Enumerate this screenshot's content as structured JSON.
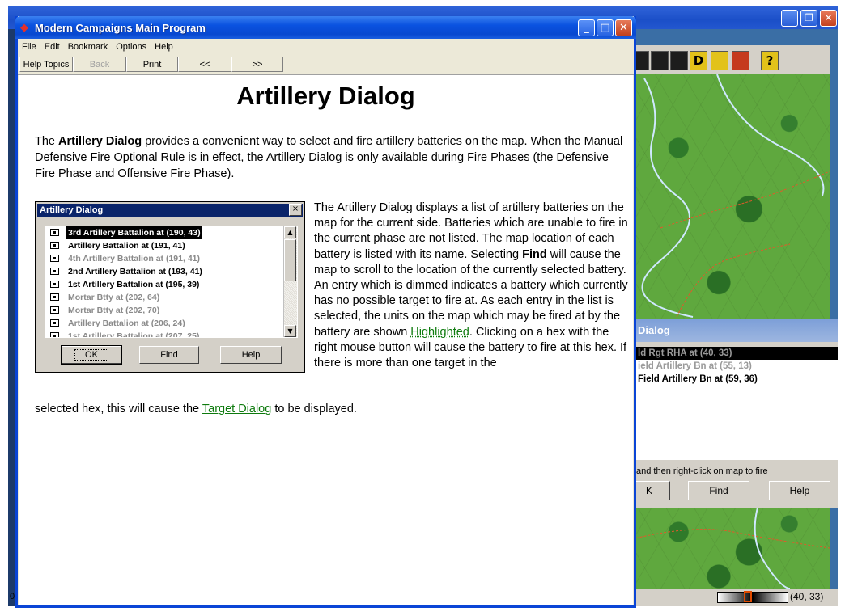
{
  "help_window": {
    "title": "Modern Campaigns Main Program",
    "menu": [
      "File",
      "Edit",
      "Bookmark",
      "Options",
      "Help"
    ],
    "toolbar": {
      "help_topics": "Help Topics",
      "back": "Back",
      "print": "Print",
      "prev": "<<",
      "next": ">>"
    }
  },
  "page": {
    "title": "Artillery Dialog",
    "intro_prefix": "The ",
    "intro_bold": "Artillery Dialog",
    "intro_rest": " provides a convenient way to select and fire artillery batteries on the map.  When the Manual Defensive Fire Optional Rule is in effect, the Artillery Dialog is only available during Fire Phases (the Defensive Fire Phase and Offensive Fire Phase).",
    "body_part1": "The Artillery Dialog displays a list of artillery batteries on the map for the current side.  Batteries which are unable to fire in the current phase are not listed.  The map location of each battery is listed with its name. Selecting ",
    "body_find": "Find",
    "body_part2": " will cause the map to scroll to the location of the currently selected battery.  An entry which is dimmed indicates a battery which currently has no possible target to fire at.  As each entry in the list is selected, the units on the map which may be fired at by the battery are shown ",
    "link_highlighted": "Highlighted",
    "body_part3": ".  Clicking on a hex with the right mouse button will cause the battery to fire at this hex.  If there is more than one target in the",
    "tail_part1": "selected hex, this will cause the ",
    "link_target_dialog": "Target Dialog",
    "tail_part2": " to be displayed."
  },
  "embedded_dialog": {
    "title": "Artillery Dialog",
    "close": "×",
    "rows": [
      {
        "text": "3rd Artillery Battalion at (190, 43)",
        "state": "selected"
      },
      {
        "text": "Artillery Battalion at (191, 41)",
        "state": "normal"
      },
      {
        "text": "4th Artillery Battalion at (191, 41)",
        "state": "dimmed"
      },
      {
        "text": "2nd Artillery Battalion at (193, 41)",
        "state": "normal"
      },
      {
        "text": "1st Artillery Battalion at (195, 39)",
        "state": "normal"
      },
      {
        "text": "Mortar Btty at (202, 64)",
        "state": "dimmed"
      },
      {
        "text": "Mortar Btty at (202, 70)",
        "state": "dimmed"
      },
      {
        "text": "Artillery Battalion at (206, 24)",
        "state": "dimmed"
      },
      {
        "text": "1st Artillery Battalion at (207, 25)",
        "state": "dimmed"
      }
    ],
    "buttons": {
      "ok": "OK",
      "find": "Find",
      "help": "Help"
    }
  },
  "background_app": {
    "dialog_title": "Dialog",
    "rows": [
      {
        "text": "ld Rgt RHA at (40, 33)",
        "state": "selected"
      },
      {
        "text": "ield Artillery Bn at (55, 13)",
        "state": "dimmed"
      },
      {
        "text": "Field Artillery Bn at (59, 36)",
        "state": "normal"
      }
    ],
    "hint": "and then right-click on map to fire",
    "buttons": {
      "ok": "K",
      "find": "Find",
      "help": "Help"
    },
    "status_coord": "(40, 33)",
    "status_left": "0",
    "toolbar_icons": [
      "black-icon",
      "binoculars-icon",
      "target-icon",
      "d-icon",
      "pause-icon",
      "flag-icon",
      "help-icon"
    ],
    "help_icon_label": "?",
    "d_icon_label": "D"
  }
}
